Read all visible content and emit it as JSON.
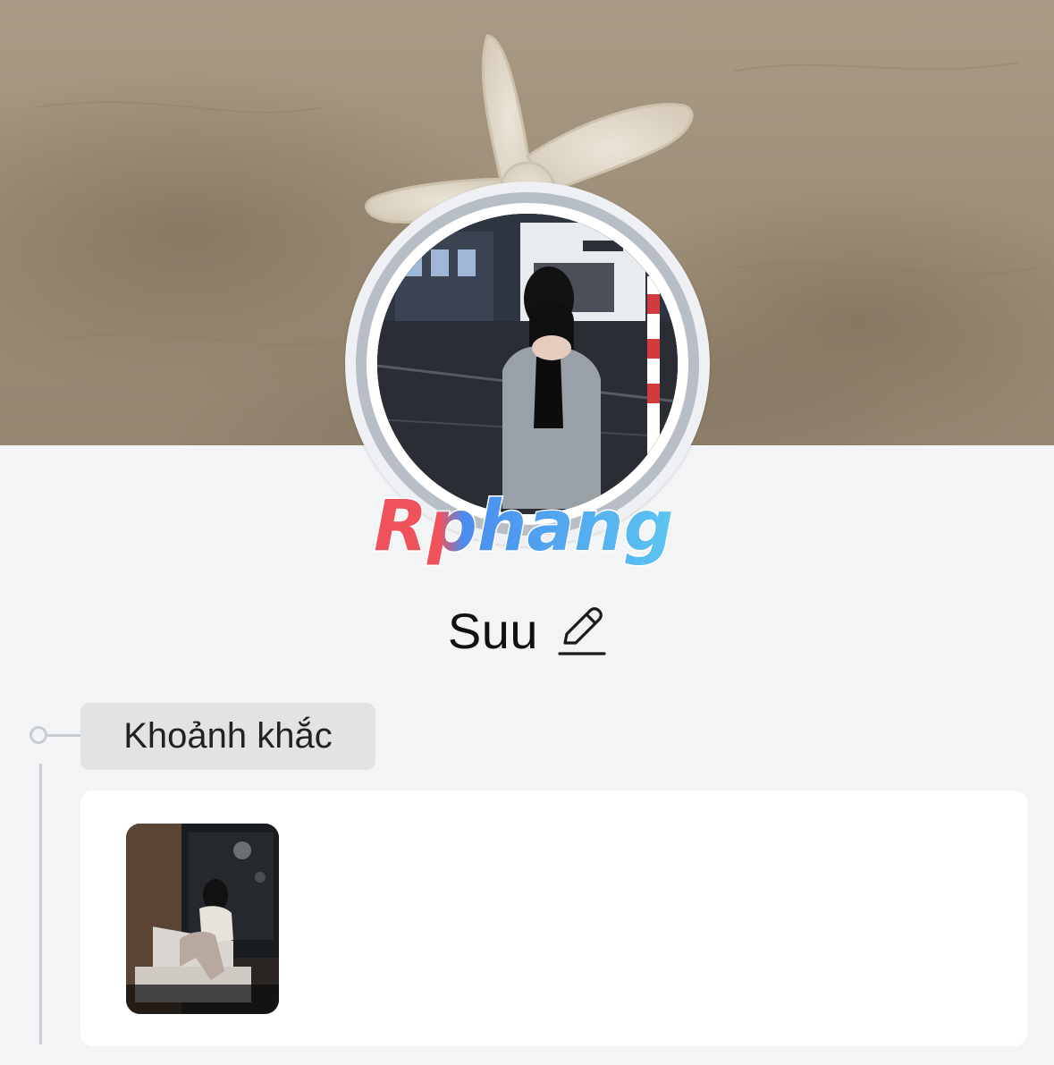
{
  "profile": {
    "name": "Suu",
    "cover_icon": "starfish-on-sand-photo",
    "avatar_icon": "profile-photo",
    "edit_icon": "pencil-icon"
  },
  "watermark": {
    "text": "Rphang"
  },
  "moments": {
    "section_label": "Khoảnh khắc",
    "items": [
      {
        "icon": "moment-photo"
      }
    ]
  },
  "colors": {
    "page_background": "#f3f4f6",
    "card_background": "#ffffff",
    "tag_background": "#e2e3e5",
    "timeline_line": "#c9ccd1",
    "watermark_red": "#f0525c",
    "watermark_blue": "#4a8cf0"
  }
}
